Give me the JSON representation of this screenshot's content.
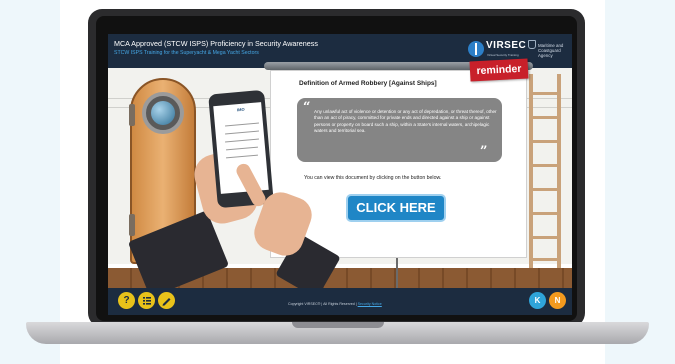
{
  "course": {
    "title": "MCA Approved (STCW ISPS) Proficiency in Security Awareness",
    "subtitle": "STCW ISPS Training for the Superyacht & Mega Yacht Sectors"
  },
  "logos": {
    "brand": "VIRSEC",
    "brand_tagline": "Virtual Security Training",
    "agency": "Maritime and Coastguard Agency"
  },
  "slide": {
    "badge": "reminder",
    "heading": "Definition of Armed Robbery [Against Ships]",
    "quote": "Any unlawful act of violence or detention or any act of depredation, or threat thereof, other than an act of piracy, committed for private ends and directed against a ship or against persons or property on board such a ship, within a State's internal waters, archipelagic waters and territorial sea.",
    "instruction": "You can view this document by clicking on the button below.",
    "cta_label": "CLICK HERE",
    "phone_doc_header": "IMO"
  },
  "footer": {
    "copyright": "Copyright VIRSEC® | All Rights Reserved |",
    "link": "Security Notice",
    "help_label": "?",
    "prev_label": "K",
    "next_label": "N"
  },
  "colors": {
    "header_bg": "#1c2c40",
    "accent_blue": "#1f86c6",
    "reminder_red": "#c8202a",
    "help_yellow": "#e8c21a",
    "prev_blue": "#2fa4d9",
    "next_orange": "#f39a1e"
  },
  "icons": [
    "help-icon",
    "menu-list-icon",
    "pencil-icon",
    "previous-icon",
    "next-icon"
  ]
}
